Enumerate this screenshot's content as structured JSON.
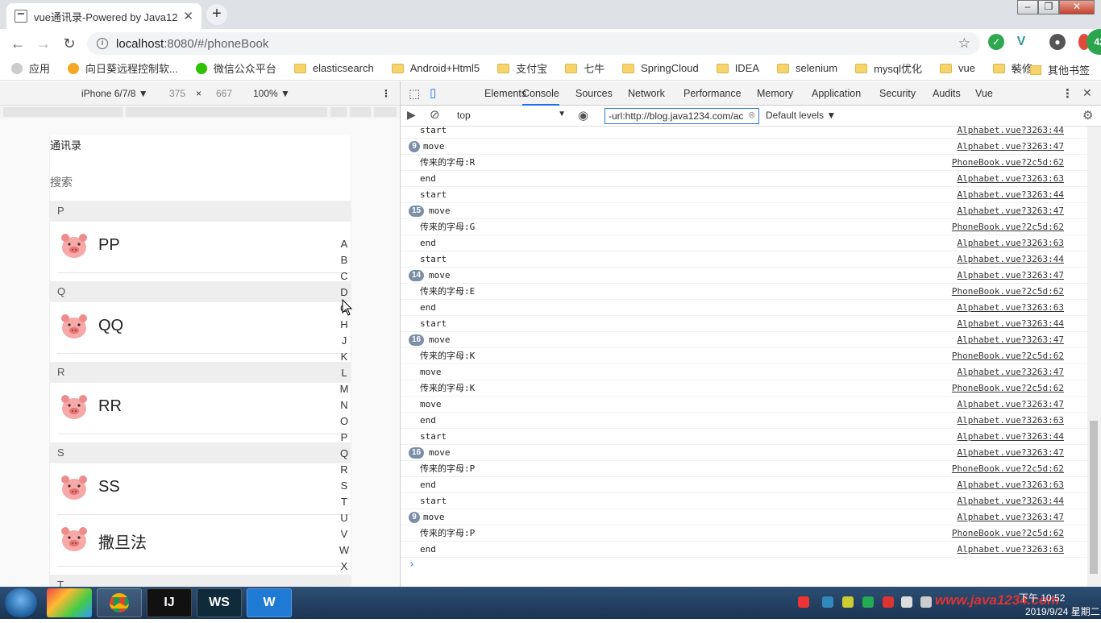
{
  "browser": {
    "tab_title": "vue通讯录-Powered by Java12",
    "tab_close": "✕",
    "new_tab": "+",
    "url_host": "localhost",
    "url_rest": ":8080/#/phoneBook",
    "profile_badge": "42"
  },
  "bookmarks": {
    "items": [
      {
        "label": "应用",
        "icon": "apps-icon"
      },
      {
        "label": "向日葵远程控制软...",
        "icon": "sunflower-icon"
      },
      {
        "label": "微信公众平台",
        "icon": "wechat-icon"
      },
      {
        "label": "elasticsearch",
        "icon": "folder-icon"
      },
      {
        "label": "Android+Html5",
        "icon": "folder-icon"
      },
      {
        "label": "支付宝",
        "icon": "folder-icon"
      },
      {
        "label": "七牛",
        "icon": "folder-icon"
      },
      {
        "label": "SpringCloud",
        "icon": "folder-icon"
      },
      {
        "label": "IDEA",
        "icon": "folder-icon"
      },
      {
        "label": "selenium",
        "icon": "folder-icon"
      },
      {
        "label": "mysql优化",
        "icon": "folder-icon"
      },
      {
        "label": "vue",
        "icon": "folder-icon"
      },
      {
        "label": "装修",
        "icon": "folder-icon"
      }
    ],
    "more": "»",
    "other": "其他书签"
  },
  "device_toolbar": {
    "device": "iPhone 6/7/8 ▼",
    "width": "375",
    "times": "×",
    "height": "667",
    "zoom": "100% ▼"
  },
  "page": {
    "title": "通讯录",
    "search": "搜索",
    "sections": [
      {
        "letter": "P",
        "contacts": [
          "PP"
        ]
      },
      {
        "letter": "Q",
        "contacts": [
          "QQ"
        ]
      },
      {
        "letter": "R",
        "contacts": [
          "RR"
        ]
      },
      {
        "letter": "S",
        "contacts": [
          "SS",
          "撒旦法"
        ]
      },
      {
        "letter": "T",
        "contacts": []
      }
    ],
    "alphabet": [
      "A",
      "B",
      "C",
      "D",
      "G",
      "H",
      "J",
      "K",
      "L",
      "M",
      "N",
      "O",
      "P",
      "Q",
      "R",
      "S",
      "T",
      "U",
      "V",
      "W",
      "X"
    ]
  },
  "devtools": {
    "tabs": [
      "Elements",
      "Console",
      "Sources",
      "Network",
      "Performance",
      "Memory",
      "Application",
      "Security",
      "Audits",
      "Vue"
    ],
    "context": "top",
    "filter": "-url:http://blog.java1234.com/ac",
    "levels": "Default levels ▼",
    "console": [
      {
        "msg": "start",
        "badge": "",
        "src": "Alphabet.vue?3263:44"
      },
      {
        "msg": "move",
        "badge": "9",
        "src": "Alphabet.vue?3263:47"
      },
      {
        "msg": "传来的字母:R",
        "badge": "",
        "src": "PhoneBook.vue?2c5d:62"
      },
      {
        "msg": "end",
        "badge": "",
        "src": "Alphabet.vue?3263:63"
      },
      {
        "msg": "start",
        "badge": "",
        "src": "Alphabet.vue?3263:44"
      },
      {
        "msg": "move",
        "badge": "15",
        "src": "Alphabet.vue?3263:47"
      },
      {
        "msg": "传来的字母:G",
        "badge": "",
        "src": "PhoneBook.vue?2c5d:62"
      },
      {
        "msg": "end",
        "badge": "",
        "src": "Alphabet.vue?3263:63"
      },
      {
        "msg": "start",
        "badge": "",
        "src": "Alphabet.vue?3263:44"
      },
      {
        "msg": "move",
        "badge": "14",
        "src": "Alphabet.vue?3263:47"
      },
      {
        "msg": "传来的字母:E",
        "badge": "",
        "src": "PhoneBook.vue?2c5d:62"
      },
      {
        "msg": "end",
        "badge": "",
        "src": "Alphabet.vue?3263:63"
      },
      {
        "msg": "start",
        "badge": "",
        "src": "Alphabet.vue?3263:44"
      },
      {
        "msg": "move",
        "badge": "16",
        "src": "Alphabet.vue?3263:47"
      },
      {
        "msg": "传来的字母:K",
        "badge": "",
        "src": "PhoneBook.vue?2c5d:62"
      },
      {
        "msg": "move",
        "badge": "",
        "src": "Alphabet.vue?3263:47"
      },
      {
        "msg": "传来的字母:K",
        "badge": "",
        "src": "PhoneBook.vue?2c5d:62"
      },
      {
        "msg": "move",
        "badge": "",
        "src": "Alphabet.vue?3263:47"
      },
      {
        "msg": "end",
        "badge": "",
        "src": "Alphabet.vue?3263:63"
      },
      {
        "msg": "start",
        "badge": "",
        "src": "Alphabet.vue?3263:44"
      },
      {
        "msg": "move",
        "badge": "16",
        "src": "Alphabet.vue?3263:47"
      },
      {
        "msg": "传来的字母:P",
        "badge": "",
        "src": "PhoneBook.vue?2c5d:62"
      },
      {
        "msg": "end",
        "badge": "",
        "src": "Alphabet.vue?3263:63"
      },
      {
        "msg": "start",
        "badge": "",
        "src": "Alphabet.vue?3263:44"
      },
      {
        "msg": "move",
        "badge": "9",
        "src": "Alphabet.vue?3263:47"
      },
      {
        "msg": "传来的字母:P",
        "badge": "",
        "src": "PhoneBook.vue?2c5d:62"
      },
      {
        "msg": "end",
        "badge": "",
        "src": "Alphabet.vue?3263:63"
      }
    ],
    "prompt": "›"
  },
  "taskbar": {
    "apps": [
      "IJ",
      "WS",
      "W"
    ],
    "watermark": "www.java1234.com",
    "time": "下午 10:52",
    "date": "2019/9/24 星期二"
  }
}
